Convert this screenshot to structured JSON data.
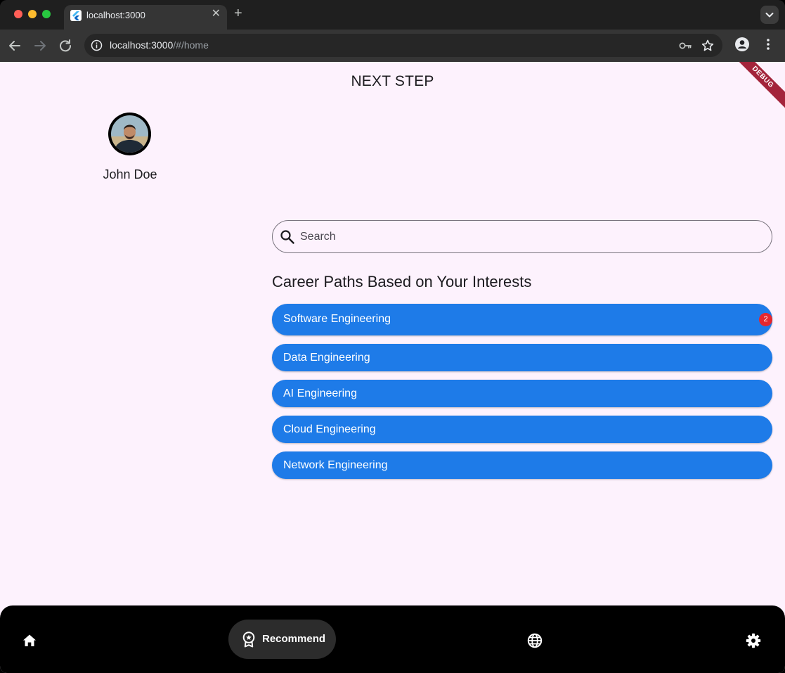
{
  "browser": {
    "tab_title": "localhost:3000",
    "url_host": "localhost:3000",
    "url_path": "/#/home"
  },
  "app": {
    "title": "NEXT STEP",
    "debug_label": "DEBUG"
  },
  "profile": {
    "name": "John Doe"
  },
  "search": {
    "placeholder": "Search",
    "value": ""
  },
  "careers": {
    "heading": "Career Paths Based on Your Interests",
    "items": [
      {
        "label": "Software Engineering",
        "badge": "2"
      },
      {
        "label": "Data Engineering"
      },
      {
        "label": "AI Engineering"
      },
      {
        "label": "Cloud Engineering"
      },
      {
        "label": "Network Engineering"
      }
    ]
  },
  "colors": {
    "background": "#fdf2fd",
    "career_item": "#1e7be8",
    "badge": "#e5272d",
    "nav_bar": "#000000"
  },
  "bottom_nav": {
    "items": [
      {
        "icon": "home-icon"
      },
      {
        "icon": "award-icon",
        "label": "Recommend",
        "selected": true
      },
      {
        "icon": "globe-icon"
      },
      {
        "icon": "gear-icon"
      }
    ]
  }
}
